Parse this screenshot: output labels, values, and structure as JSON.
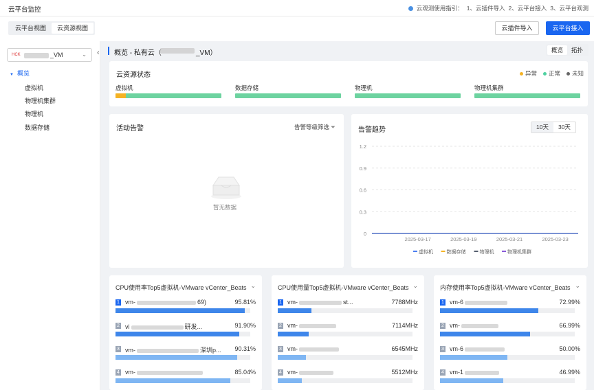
{
  "app_title": "云平台监控",
  "guide": {
    "text": "云观测使用指引：",
    "steps": [
      "1、云插件导入",
      "2、云平台接入",
      "3、云平台观测"
    ]
  },
  "view_tabs": [
    {
      "label": "云平台视图",
      "active": false
    },
    {
      "label": "云资源视图",
      "active": true
    }
  ],
  "buttons": {
    "plugin_import": "云插件导入",
    "platform_access": "云平台接入"
  },
  "sidebar": {
    "cloud_select": {
      "badge": "HCK",
      "value": "_VM"
    },
    "collapse_icon": "chevron-left-icon",
    "tree_root": "概览",
    "tree_items": [
      "虚拟机",
      "物理机集群",
      "物理机",
      "数据存储"
    ]
  },
  "main": {
    "title_prefix": "概览 - 私有云（",
    "title_suffix": "_VM）",
    "mode_tabs": [
      {
        "label": "概览",
        "active": true
      },
      {
        "label": "拓扑",
        "active": false
      }
    ]
  },
  "status": {
    "title": "云资源状态",
    "legend": [
      {
        "label": "异常",
        "color": "#f5b324"
      },
      {
        "label": "正常",
        "color": "#4fd1a0"
      },
      {
        "label": "未知",
        "color": "#666666"
      }
    ],
    "resources": [
      {
        "label": "虚拟机",
        "abnormal_fraction": 0.1
      },
      {
        "label": "数据存储",
        "abnormal_fraction": 0
      },
      {
        "label": "物理机",
        "abnormal_fraction": 0
      },
      {
        "label": "物理机集群",
        "abnormal_fraction": 0
      }
    ]
  },
  "alarms": {
    "title": "活动告警",
    "filter": "告警等级筛选",
    "empty": "暂无数据"
  },
  "trend": {
    "title": "告警趋势",
    "ranges": [
      {
        "label": "10天",
        "active": true
      },
      {
        "label": "30天",
        "active": false
      }
    ],
    "chart_data": {
      "type": "line",
      "x": [
        "2025-03-15",
        "2025-03-16",
        "2025-03-17",
        "2025-03-18",
        "2025-03-19",
        "2025-03-20",
        "2025-03-21",
        "2025-03-22",
        "2025-03-23",
        "2025-03-24"
      ],
      "x_tick_labels": [
        "2025-03-17",
        "2025-03-19",
        "2025-03-21",
        "2025-03-23"
      ],
      "y_tick_labels": [
        "1.2",
        "0.9",
        "0.6",
        "0.3",
        "0"
      ],
      "ylim": [
        0,
        1.2
      ],
      "grid": true,
      "legend_position": "bottom",
      "series": [
        {
          "name": "虚拟机",
          "color": "#4a7ef0",
          "values": [
            0,
            0,
            0,
            0,
            0,
            0,
            0,
            0,
            0,
            0
          ]
        },
        {
          "name": "数据存储",
          "color": "#f5b324",
          "values": [
            0,
            0,
            0,
            0,
            0,
            0,
            0,
            0,
            0,
            0
          ]
        },
        {
          "name": "物理机",
          "color": "#555e6e",
          "values": [
            0,
            0,
            0,
            0,
            0,
            0,
            0,
            0,
            0,
            0
          ]
        },
        {
          "name": "物理机集群",
          "color": "#8a5cd8",
          "values": [
            0,
            0,
            0,
            0,
            0,
            0,
            0,
            0,
            0,
            0
          ]
        }
      ]
    }
  },
  "top5": [
    {
      "title": "CPU使用率Top5虚拟机-VMware vCenter_Beats",
      "bar_color": "#3e86ea",
      "rows": [
        {
          "rank": "1",
          "prefix": "vm-",
          "suffix": "69)",
          "value": "95.81%",
          "fraction": 0.958
        },
        {
          "rank": "2",
          "prefix": "vi",
          "suffix": "研发...",
          "value": "91.90%",
          "fraction": 0.919
        },
        {
          "rank": "3",
          "prefix": "vm-",
          "suffix": "深圳p...",
          "value": "90.31%",
          "fraction": 0.903
        },
        {
          "rank": "4",
          "prefix": "vm-",
          "suffix": "",
          "value": "85.04%",
          "fraction": 0.85
        }
      ]
    },
    {
      "title": "CPU使用量Top5虚拟机-VMware vCenter_Beats",
      "bar_color": "#3e86ea",
      "rows": [
        {
          "rank": "1",
          "prefix": "vm-",
          "suffix": "st...",
          "value": "7788MHz",
          "fraction": 0.25
        },
        {
          "rank": "2",
          "prefix": "vm-",
          "suffix": "",
          "value": "7114MHz",
          "fraction": 0.23
        },
        {
          "rank": "3",
          "prefix": "vm-",
          "suffix": "",
          "value": "6545MHz",
          "fraction": 0.21
        },
        {
          "rank": "4",
          "prefix": "vm-",
          "suffix": "",
          "value": "5512MHz",
          "fraction": 0.18
        }
      ]
    },
    {
      "title": "内存使用率Top5虚拟机-VMware vCenter_Beats",
      "bar_color": "#3e86ea",
      "rows": [
        {
          "rank": "1",
          "prefix": "vm-6",
          "suffix": "",
          "value": "72.99%",
          "fraction": 0.73
        },
        {
          "rank": "2",
          "prefix": "vm-",
          "suffix": "",
          "value": "66.99%",
          "fraction": 0.67
        },
        {
          "rank": "3",
          "prefix": "vm-6",
          "suffix": "",
          "value": "50.00%",
          "fraction": 0.5
        },
        {
          "rank": "4",
          "prefix": "vm-1",
          "suffix": "",
          "value": "46.99%",
          "fraction": 0.47
        }
      ]
    }
  ]
}
